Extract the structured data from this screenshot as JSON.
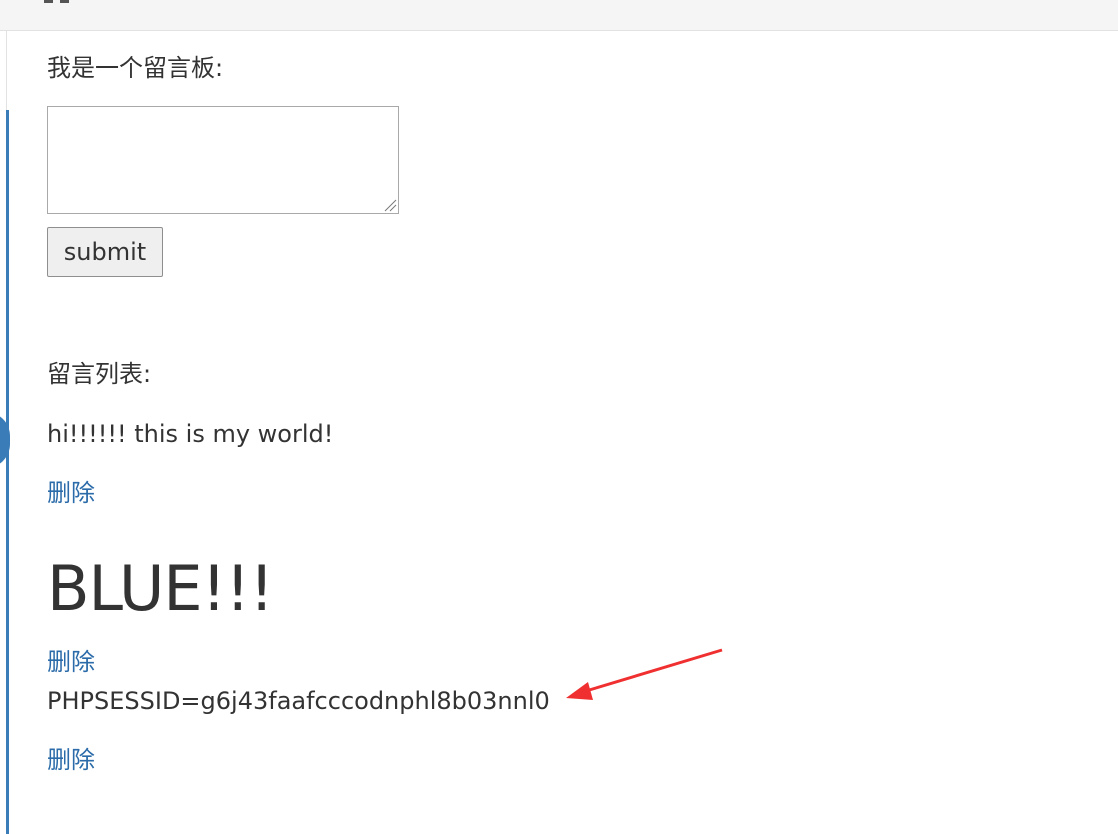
{
  "board": {
    "label": "我是一个留言板:",
    "input_value": "",
    "submit_label": "submit"
  },
  "list": {
    "heading": "留言列表:",
    "messages": [
      {
        "text": "hi!!!!!! this is my world!",
        "delete_label": "删除"
      },
      {
        "heading": "BLUE!!!",
        "delete_label": "删除"
      },
      {
        "text": "PHPSESSID=g6j43faafcccodnphl8b03nnl0",
        "delete_label": "删除"
      }
    ]
  },
  "colors": {
    "link": "#2b6ba9",
    "sidebar_accent": "#3a7cb8",
    "annotation_arrow": "#f03030"
  },
  "icons": {
    "header_icon": "grid-icon",
    "resize_grip": "resize-grip-icon",
    "annotation": "red-arrow-icon"
  }
}
